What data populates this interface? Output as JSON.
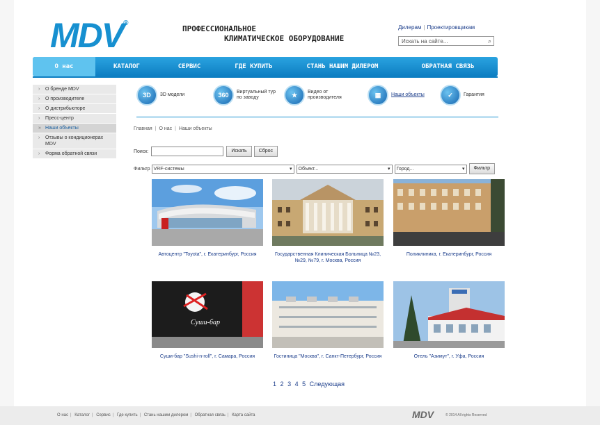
{
  "header": {
    "logo": "MDV",
    "logo_mark": "®",
    "tagline_line1": "ПРОФЕССИОНАЛЬНОЕ",
    "tagline_line2": "КЛИМАТИЧЕСКОЕ ОБОРУДОВАНИЕ",
    "link_dealers": "Дилерам",
    "link_designers": "Проектировщикам",
    "search_placeholder": "Искать на сайте..."
  },
  "nav": {
    "items": [
      "О нас",
      "КАТАЛОГ",
      "СЕРВИС",
      "ГДЕ КУПИТЬ",
      "СТАНЬ НАШИМ ДИЛЕРОМ",
      "ОБРАТНАЯ СВЯЗЬ"
    ]
  },
  "sidebar": {
    "items": [
      "О бренде MDV",
      "О производителе",
      "О дистрибьюторе",
      "Пресс-центр",
      "Наши объекты",
      "Отзывы о кондиционерах MDV",
      "Форма обратной связи"
    ]
  },
  "icons": [
    {
      "badge": "3D",
      "label": "3D модели"
    },
    {
      "badge": "360",
      "label": "Виртуальный тур по заводу"
    },
    {
      "badge": "★",
      "label": "Видео от производителя"
    },
    {
      "badge": "▦",
      "label": "Наши объекты"
    },
    {
      "badge": "✓",
      "label": "Гарантия"
    }
  ],
  "breadcrumb": [
    "Главная",
    "О нас",
    "Наши объекты"
  ],
  "form": {
    "search_label": "Поиск:",
    "search_button": "Искать",
    "reset_button": "Сброс",
    "filter_label": "Фильтр",
    "select_system": "VRF-системы",
    "select_object": "Объект...",
    "select_city": "Город...",
    "filter_button": "Фильтр"
  },
  "objects": [
    {
      "caption": "Автоцентр \"Toyota\", г. Екатеринбург, Россия"
    },
    {
      "caption": "Государственная Клиническая Больница №23, №29, №79, г. Москва, Россия"
    },
    {
      "caption": "Поликлиника, г. Екатеринбург, Россия"
    },
    {
      "caption": "Суши-бар \"Sushi-n-roll\", г. Самара, Россия"
    },
    {
      "caption": "Гостиница \"Москва\", г. Санкт-Петербург, Россия"
    },
    {
      "caption": "Отель \"Азимут\", г. Уфа, Россия"
    }
  ],
  "pager": {
    "pages": [
      "1",
      "2",
      "3",
      "4",
      "5"
    ],
    "next": "Следующая"
  },
  "footer": {
    "links": [
      "О нас",
      "Каталог",
      "Сервис",
      "Где купить",
      "Стань нашим дилером",
      "Обратная связь",
      "Карта сайта"
    ],
    "logo": "MDV",
    "copyright": "© 2014 All rights Reserved"
  }
}
